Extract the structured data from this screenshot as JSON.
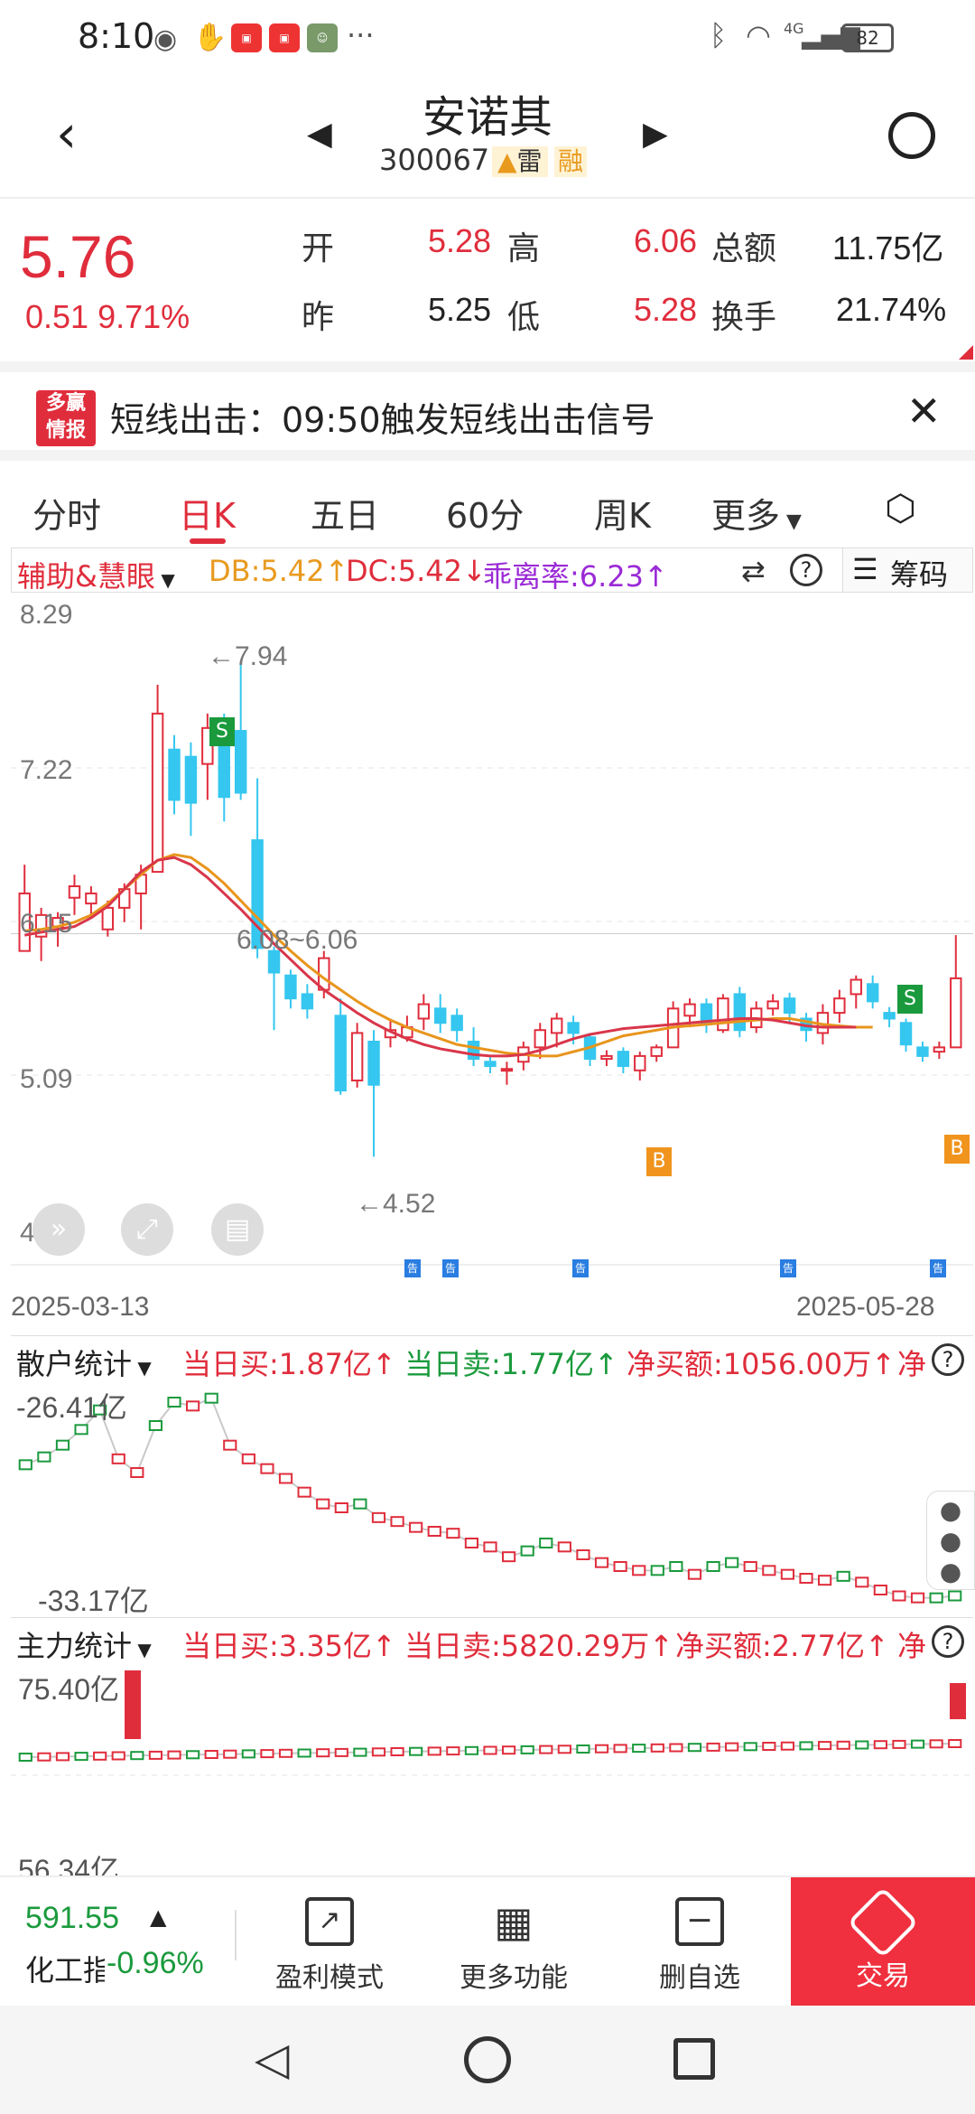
{
  "status_bar": {
    "time": "8:10",
    "battery": "82",
    "network": "4G"
  },
  "header": {
    "stock_name": "安诺其",
    "stock_code": "300067",
    "tag_lei": "雷",
    "tag_rong": "融"
  },
  "quote": {
    "price": "5.76",
    "change": "0.51",
    "change_pct": "9.71%",
    "open_label": "开",
    "open": "5.28",
    "high_label": "高",
    "high": "6.06",
    "amount_label": "总额",
    "amount": "11.75亿",
    "prev_label": "昨",
    "prev": "5.25",
    "low_label": "低",
    "low": "5.28",
    "turnover_label": "换手",
    "turnover": "21.74%"
  },
  "alert": {
    "logo_top": "多赢",
    "logo_bottom": "情报",
    "text": "短线出击：09:50触发短线出击信号"
  },
  "tabs": [
    "分时",
    "日K",
    "五日",
    "60分",
    "周K",
    "更多"
  ],
  "active_tab": 1,
  "indicator_bar": {
    "name": "辅助&慧眼",
    "db": "DB:5.42↑",
    "dc": "DC:5.42↓",
    "deviation": "乖离率:6.23↑",
    "chips": "筹码"
  },
  "kline": {
    "y_labels": [
      "8.29",
      "7.22",
      "6.15",
      "5.09",
      "4.02"
    ],
    "max_annotation": "←7.94",
    "min_annotation": "←4.52",
    "range_annotation": "6.08~6.06",
    "date_start": "2025-03-13",
    "date_end": "2025-05-28",
    "signal_s": "S",
    "signal_b": "B",
    "notice": "告"
  },
  "retail_panel": {
    "title": "散户统计",
    "buy": "当日买:1.87亿↑",
    "sell": "当日卖:1.77亿↑",
    "net": "净买额:1056.00万↑",
    "net_cut": "净",
    "top_label": "-26.41亿",
    "bottom_label": "-33.17亿"
  },
  "main_panel": {
    "title": "主力统计",
    "buy": "当日买:3.35亿↑",
    "sell": "当日卖:5820.29万↑",
    "net": "净买额:2.77亿↑",
    "net_cut": "净",
    "top_label": "75.40亿",
    "bottom_label": "56.34亿"
  },
  "bottom_bar": {
    "index_value": "591.55",
    "index_name": "化工指",
    "index_change": "-0.96%",
    "items": [
      "盈利模式",
      "更多功能",
      "删自选"
    ],
    "trade": "交易"
  },
  "chart_data": {
    "type": "candlestick",
    "x_start": "2025-03-13",
    "x_end": "2025-05-28",
    "ylim": [
      4.02,
      8.29
    ],
    "candles": [
      [
        5.95,
        6.35,
        6.0,
        6.55
      ],
      [
        6.05,
        6.2,
        5.88,
        6.25
      ],
      [
        6.12,
        6.18,
        5.98,
        6.22
      ],
      [
        6.32,
        6.4,
        6.2,
        6.48
      ],
      [
        6.28,
        6.35,
        6.18,
        6.4
      ],
      [
        6.1,
        6.25,
        6.05,
        6.3
      ],
      [
        6.25,
        6.38,
        6.15,
        6.42
      ],
      [
        6.35,
        6.48,
        6.1,
        6.55
      ],
      [
        6.5,
        7.6,
        6.5,
        7.8
      ],
      [
        7.35,
        7.0,
        6.9,
        7.45
      ],
      [
        7.3,
        6.98,
        6.75,
        7.4
      ],
      [
        7.25,
        7.5,
        7.0,
        7.6
      ],
      [
        7.55,
        7.02,
        6.85,
        7.6
      ],
      [
        7.48,
        7.05,
        7.0,
        7.94
      ],
      [
        6.72,
        5.97,
        5.9,
        7.15
      ],
      [
        5.95,
        5.8,
        5.4,
        5.98
      ],
      [
        5.78,
        5.62,
        5.55,
        5.82
      ],
      [
        5.65,
        5.55,
        5.48,
        5.72
      ],
      [
        5.68,
        5.9,
        5.62,
        5.95
      ],
      [
        5.5,
        4.98,
        4.95,
        5.62
      ],
      [
        5.05,
        5.38,
        5.0,
        5.45
      ],
      [
        5.32,
        5.02,
        4.52,
        5.4
      ],
      [
        5.35,
        5.4,
        5.28,
        5.48
      ],
      [
        5.35,
        5.42,
        5.32,
        5.5
      ],
      [
        5.48,
        5.58,
        5.4,
        5.65
      ],
      [
        5.55,
        5.45,
        5.38,
        5.65
      ],
      [
        5.5,
        5.4,
        5.32,
        5.55
      ],
      [
        5.32,
        5.2,
        5.15,
        5.42
      ],
      [
        5.18,
        5.15,
        5.1,
        5.22
      ],
      [
        5.12,
        5.13,
        5.02,
        5.18
      ],
      [
        5.18,
        5.28,
        5.12,
        5.32
      ],
      [
        5.28,
        5.4,
        5.2,
        5.45
      ],
      [
        5.38,
        5.48,
        5.28,
        5.52
      ],
      [
        5.45,
        5.38,
        5.3,
        5.5
      ],
      [
        5.35,
        5.2,
        5.15,
        5.38
      ],
      [
        5.2,
        5.22,
        5.15,
        5.26
      ],
      [
        5.25,
        5.15,
        5.1,
        5.28
      ],
      [
        5.12,
        5.22,
        5.05,
        5.25
      ],
      [
        5.22,
        5.28,
        5.18,
        5.3
      ],
      [
        5.28,
        5.55,
        5.28,
        5.6
      ],
      [
        5.5,
        5.58,
        5.42,
        5.62
      ],
      [
        5.58,
        5.45,
        5.38,
        5.62
      ],
      [
        5.4,
        5.62,
        5.38,
        5.65
      ],
      [
        5.65,
        5.4,
        5.35,
        5.7
      ],
      [
        5.42,
        5.55,
        5.38,
        5.6
      ],
      [
        5.55,
        5.6,
        5.5,
        5.65
      ],
      [
        5.62,
        5.52,
        5.45,
        5.66
      ],
      [
        5.48,
        5.4,
        5.32,
        5.52
      ],
      [
        5.38,
        5.52,
        5.3,
        5.58
      ],
      [
        5.52,
        5.62,
        5.45,
        5.68
      ],
      [
        5.65,
        5.75,
        5.55,
        5.78
      ],
      [
        5.72,
        5.6,
        5.55,
        5.78
      ],
      [
        5.52,
        5.48,
        5.42,
        5.56
      ],
      [
        5.45,
        5.3,
        5.25,
        5.48
      ],
      [
        5.28,
        5.22,
        5.18,
        5.32
      ],
      [
        5.25,
        5.28,
        5.2,
        5.32
      ],
      [
        5.28,
        5.76,
        5.28,
        6.06
      ]
    ],
    "ma_orange": [
      6.09,
      6.1,
      6.12,
      6.15,
      6.2,
      6.28,
      6.38,
      6.48,
      6.58,
      6.62,
      6.6,
      6.52,
      6.42,
      6.3,
      6.18,
      6.06,
      5.95,
      5.85,
      5.76,
      5.68,
      5.6,
      5.53,
      5.47,
      5.42,
      5.38,
      5.34,
      5.3,
      5.28,
      5.26,
      5.24,
      5.23,
      5.22,
      5.22,
      5.25,
      5.28,
      5.32,
      5.36,
      5.38,
      5.4,
      5.42,
      5.43,
      5.44,
      5.45,
      5.46,
      5.47,
      5.48,
      5.48,
      5.46,
      5.44,
      5.43,
      5.42,
      5.42
    ],
    "ma_red": [
      6.06,
      6.08,
      6.1,
      6.12,
      6.18,
      6.26,
      6.38,
      6.5,
      6.58,
      6.6,
      6.55,
      6.46,
      6.35,
      6.24,
      6.12,
      6.0,
      5.89,
      5.78,
      5.68,
      5.6,
      5.52,
      5.45,
      5.39,
      5.34,
      5.3,
      5.27,
      5.25,
      5.23,
      5.22,
      5.22,
      5.23,
      5.26,
      5.3,
      5.34,
      5.37,
      5.39,
      5.41,
      5.42,
      5.43,
      5.44,
      5.45,
      5.46,
      5.47,
      5.48,
      5.48,
      5.47,
      5.45,
      5.43,
      5.42,
      5.42,
      5.42
    ],
    "retail_net_series": [
      0.62,
      0.66,
      0.72,
      0.8,
      0.9,
      0.65,
      0.58,
      0.82,
      0.94,
      0.92,
      0.96,
      0.72,
      0.65,
      0.6,
      0.55,
      0.48,
      0.42,
      0.4,
      0.42,
      0.35,
      0.33,
      0.3,
      0.28,
      0.27,
      0.22,
      0.2,
      0.15,
      0.18,
      0.22,
      0.2,
      0.16,
      0.12,
      0.1,
      0.08,
      0.08,
      0.1,
      0.06,
      0.1,
      0.12,
      0.1,
      0.08,
      0.06,
      0.04,
      0.03,
      0.05,
      0.02,
      -0.02,
      -0.05,
      -0.06,
      -0.06,
      -0.05
    ],
    "main_net_series": [
      0.0,
      0.0,
      0.0,
      0.0,
      0.0,
      0.0,
      0.0,
      0.0,
      0.0,
      0.0,
      0.0,
      0.0,
      0.0,
      0.0,
      0.0,
      0.0,
      0.0,
      0.0,
      0.0,
      0.0,
      0.0,
      0.0,
      0.0,
      0.0,
      0.0,
      0.0,
      0.0,
      0.0,
      0.0,
      0.0,
      0.0,
      0.0,
      0.0,
      0.0,
      0.0,
      0.0,
      0.0,
      0.0,
      0.0,
      0.0,
      0.0,
      0.0,
      0.0,
      0.0,
      0.0,
      0.0,
      0.0,
      0.0,
      0.0,
      0.0,
      0.0
    ]
  }
}
